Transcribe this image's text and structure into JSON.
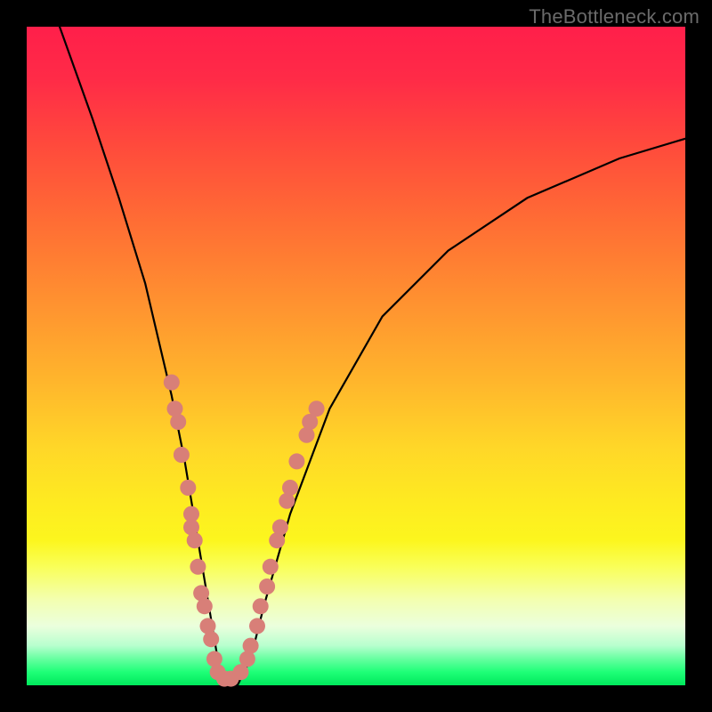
{
  "watermark": "TheBottleneck.com",
  "colors": {
    "frame": "#000000",
    "curve": "#000000",
    "marker": "#d87f78",
    "gradient_stops": [
      "#ff1f4a",
      "#ff6e34",
      "#ffd728",
      "#f9ff59",
      "#1eff77"
    ]
  },
  "chart_data": {
    "type": "line",
    "title": "",
    "xlabel": "",
    "ylabel": "",
    "xlim": [
      0,
      100
    ],
    "ylim": [
      0,
      100
    ],
    "grid": false,
    "legend": null,
    "series": [
      {
        "name": "bottleneck-curve",
        "x": [
          5,
          10,
          14,
          18,
          22,
          24,
          26,
          28,
          29,
          30,
          32,
          34,
          36,
          40,
          46,
          54,
          64,
          76,
          90,
          100
        ],
        "y": [
          100,
          86,
          74,
          61,
          44,
          34,
          22,
          10,
          4,
          0,
          0,
          4,
          12,
          26,
          42,
          56,
          66,
          74,
          80,
          83
        ]
      }
    ],
    "markers": {
      "comment": "salmon scatter markers clustered along lower V arms",
      "points": [
        {
          "x": 22.0,
          "y": 46
        },
        {
          "x": 22.5,
          "y": 42
        },
        {
          "x": 23.0,
          "y": 40
        },
        {
          "x": 23.5,
          "y": 35
        },
        {
          "x": 24.5,
          "y": 30
        },
        {
          "x": 25.0,
          "y": 26
        },
        {
          "x": 25.0,
          "y": 24
        },
        {
          "x": 25.5,
          "y": 22
        },
        {
          "x": 26.0,
          "y": 18
        },
        {
          "x": 26.5,
          "y": 14
        },
        {
          "x": 27.0,
          "y": 12
        },
        {
          "x": 27.5,
          "y": 9
        },
        {
          "x": 28.0,
          "y": 7
        },
        {
          "x": 28.5,
          "y": 4
        },
        {
          "x": 29.0,
          "y": 2
        },
        {
          "x": 30.0,
          "y": 1
        },
        {
          "x": 31.0,
          "y": 1
        },
        {
          "x": 32.5,
          "y": 2
        },
        {
          "x": 33.5,
          "y": 4
        },
        {
          "x": 34.0,
          "y": 6
        },
        {
          "x": 35.0,
          "y": 9
        },
        {
          "x": 35.5,
          "y": 12
        },
        {
          "x": 36.5,
          "y": 15
        },
        {
          "x": 37.0,
          "y": 18
        },
        {
          "x": 38.0,
          "y": 22
        },
        {
          "x": 38.5,
          "y": 24
        },
        {
          "x": 39.5,
          "y": 28
        },
        {
          "x": 40.0,
          "y": 30
        },
        {
          "x": 41.0,
          "y": 34
        },
        {
          "x": 42.5,
          "y": 38
        },
        {
          "x": 43.0,
          "y": 40
        },
        {
          "x": 44.0,
          "y": 42
        }
      ]
    }
  }
}
